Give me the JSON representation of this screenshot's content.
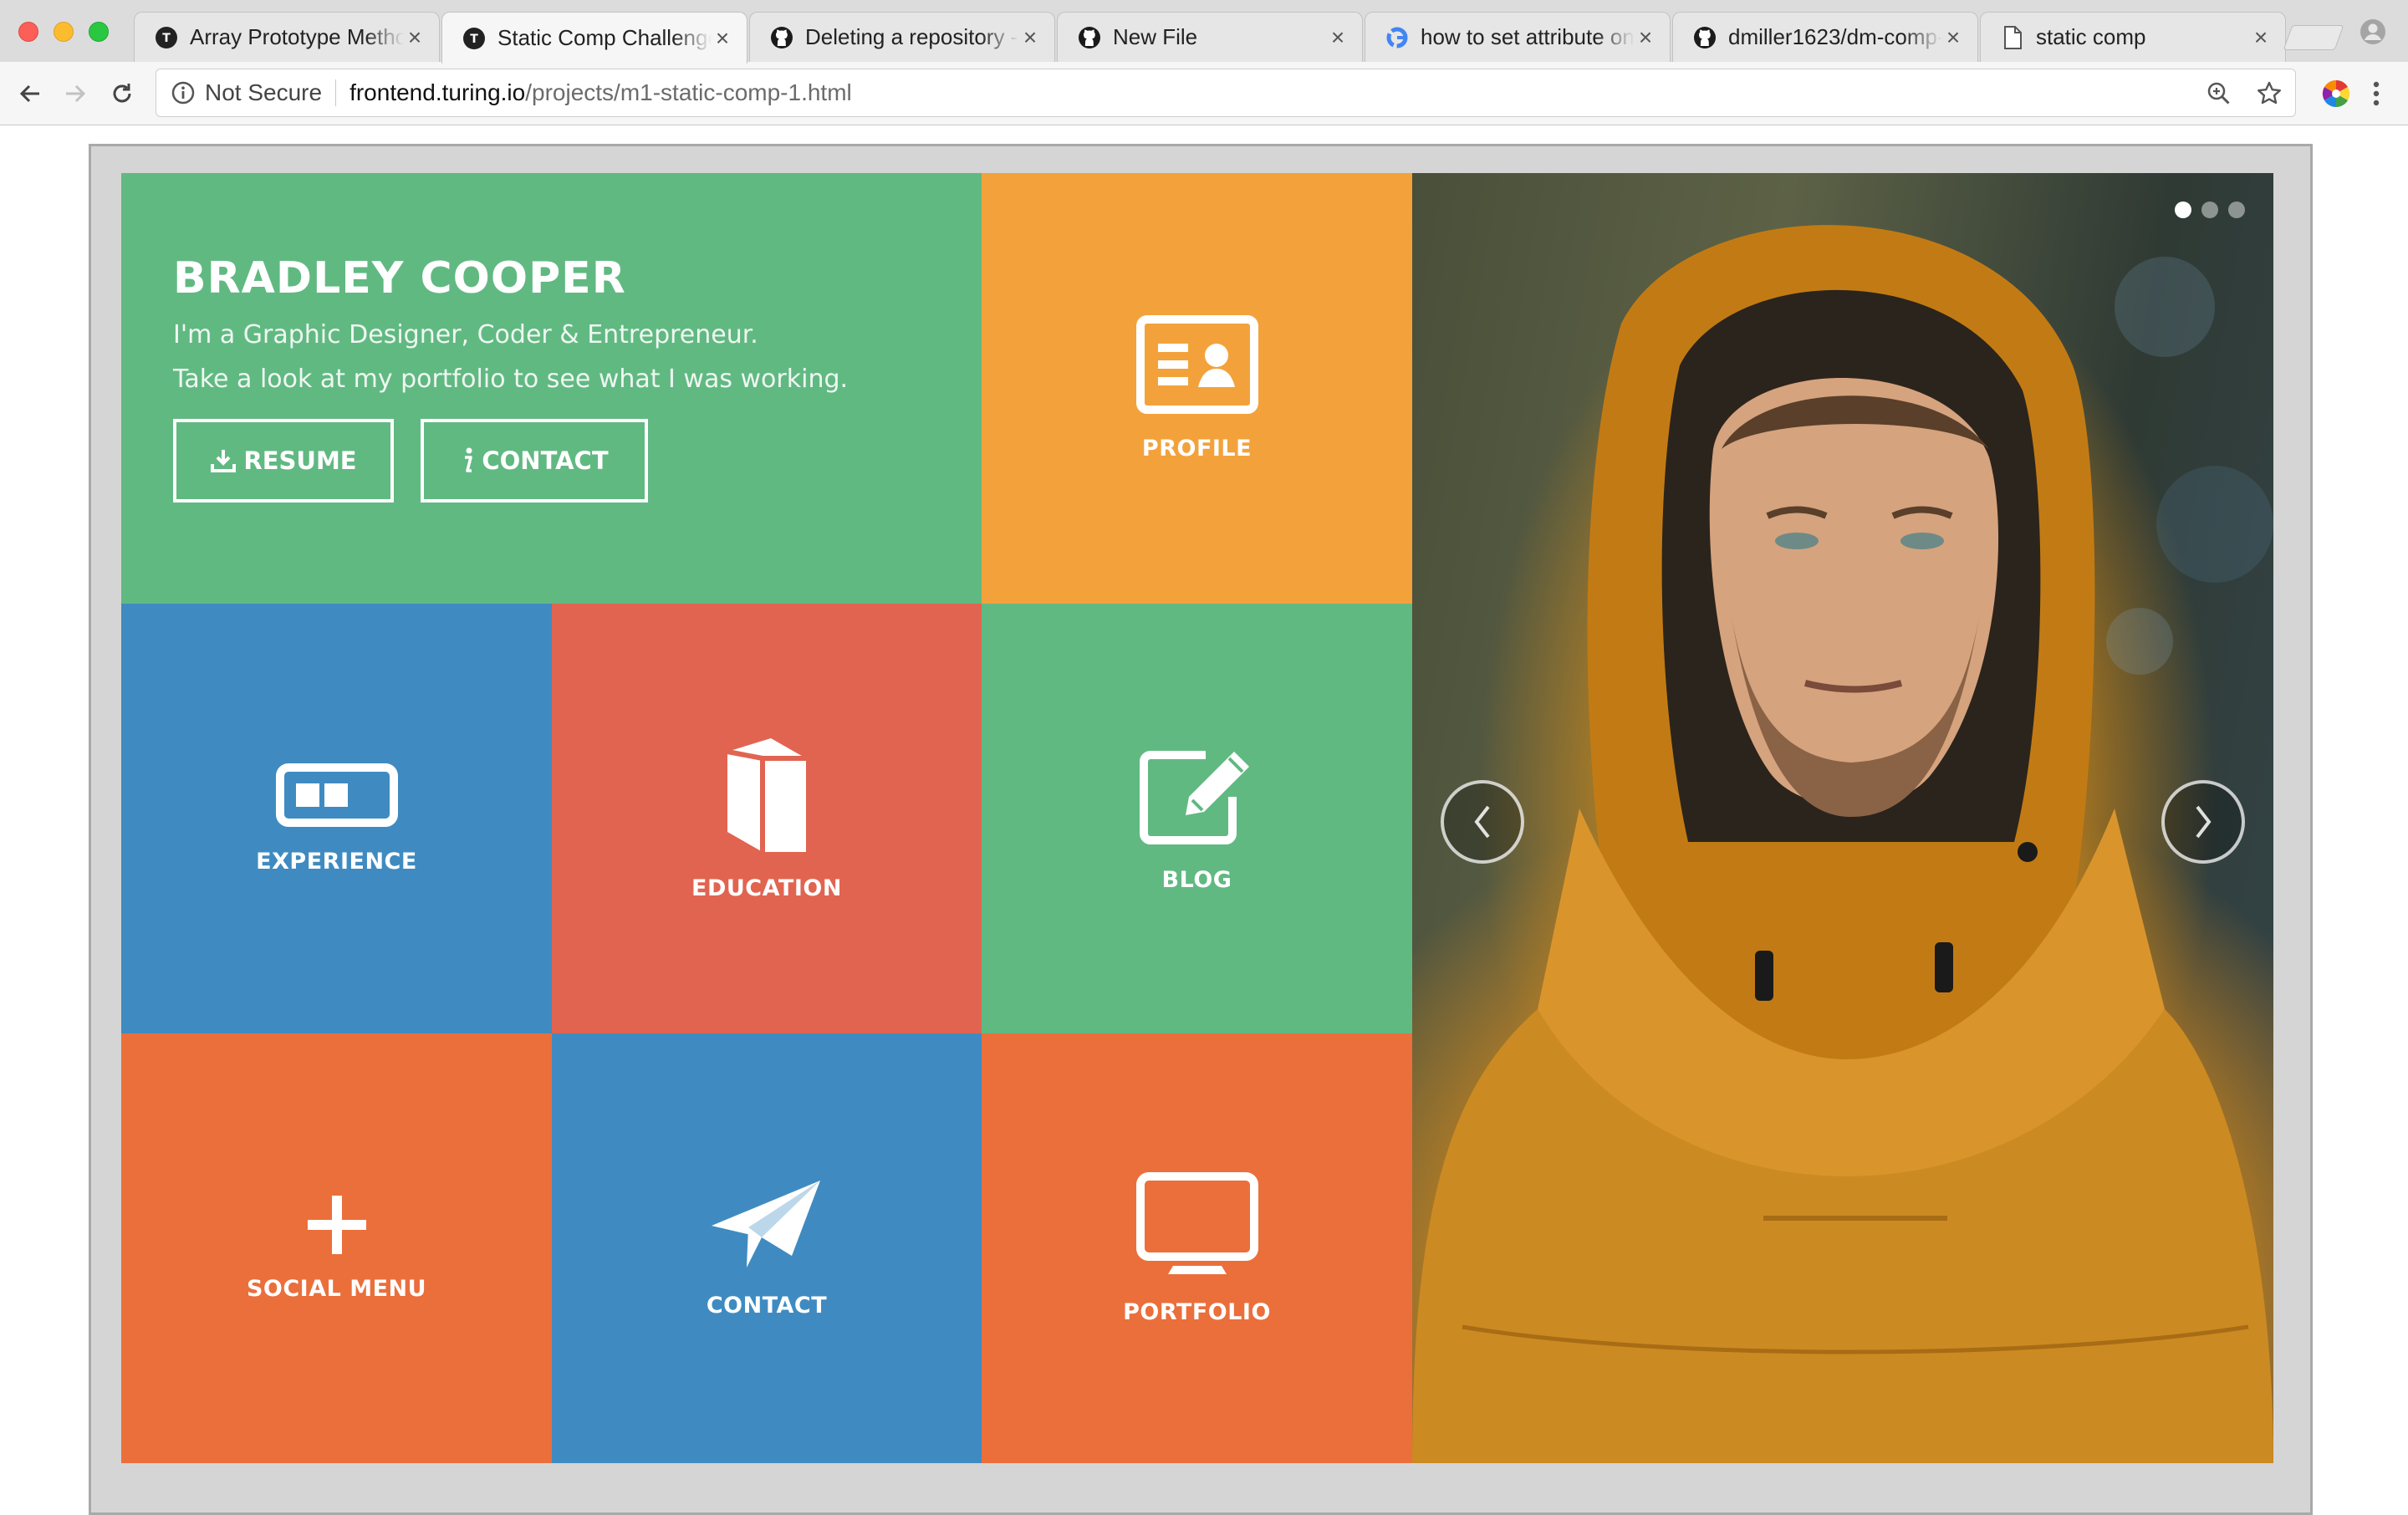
{
  "browser": {
    "tabs": [
      {
        "title": "Array Prototype Metho",
        "favicon": "turing-icon",
        "active": false
      },
      {
        "title": "Static Comp Challenge",
        "favicon": "turing-icon",
        "active": true
      },
      {
        "title": "Deleting a repository -",
        "favicon": "github-icon",
        "active": false
      },
      {
        "title": "New File",
        "favicon": "github-icon",
        "active": false
      },
      {
        "title": "how to set attribute on",
        "favicon": "google-icon",
        "active": false
      },
      {
        "title": "dmiller1623/dm-comp-",
        "favicon": "github-icon",
        "active": false
      },
      {
        "title": "static comp",
        "favicon": "file-icon",
        "active": false
      }
    ],
    "tab_close": "×",
    "address": {
      "security_label": "Not Secure",
      "host": "frontend.turing.io",
      "path": "/projects/m1-static-comp-1.html"
    }
  },
  "page": {
    "name": "BRADLEY COOPER",
    "tagline_1": "I'm a Graphic Designer, Coder & Entrepreneur.",
    "tagline_2": "Take a look at my portfolio to see what I was working.",
    "resume_button": "RESUME",
    "contact_button": "CONTACT",
    "tiles": {
      "profile": "PROFILE",
      "experience": "EXPERIENCE",
      "education": "EDUCATION",
      "blog": "BLOG",
      "social_menu": "SOCIAL MENU",
      "contact": "CONTACT",
      "portfolio": "PORTFOLIO"
    },
    "carousel": {
      "slides": 3,
      "active_slide": 1,
      "prev_glyph": "‹",
      "next_glyph": "›"
    },
    "colors": {
      "green": "#61b982",
      "amber": "#f3a23b",
      "blue": "#3f8bc1",
      "red": "#e16451",
      "orange": "#ea6f3b"
    }
  }
}
